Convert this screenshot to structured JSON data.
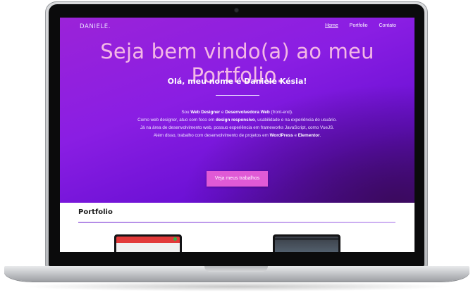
{
  "site": {
    "logo": "DANIELE.",
    "nav": [
      {
        "label": "Home",
        "active": true
      },
      {
        "label": "Portfolio",
        "active": false
      },
      {
        "label": "Contato",
        "active": false
      }
    ]
  },
  "hero": {
    "title": "Seja bem vindo(a) ao meu Portfolio.",
    "subtitle": "Olá, meu nome é Daniele Késia!",
    "intro": {
      "line1_a": "Sou ",
      "line1_b": "Web Designer",
      "line1_c": " e ",
      "line1_d": "Desenvolvedora Web",
      "line1_e": " (front-end).",
      "line2_a": "Como web designer, atuo com foco em ",
      "line2_b": "design responsivo",
      "line2_c": ", usabilidade e na experiência do usuário.",
      "line3": "Já na área de desenvolvimento web, possuo experiência em frameworks JavaScript, como VueJS.",
      "line4_a": "Além disso, trabalho com desenvolvimento de projetos em ",
      "line4_b": "WordPress",
      "line4_c": " e ",
      "line4_d": "Elementor",
      "line4_e": "."
    },
    "cta_label": "Veja meus trabalhos"
  },
  "portfolio": {
    "title": "Portfolio"
  },
  "colors": {
    "hero_gradient_start": "#9b23d8",
    "hero_gradient_end": "#4a0aa0",
    "title_pink": "#f4b8e6",
    "cta_bg": "#e05ad6",
    "rule": "#b28ae6"
  }
}
